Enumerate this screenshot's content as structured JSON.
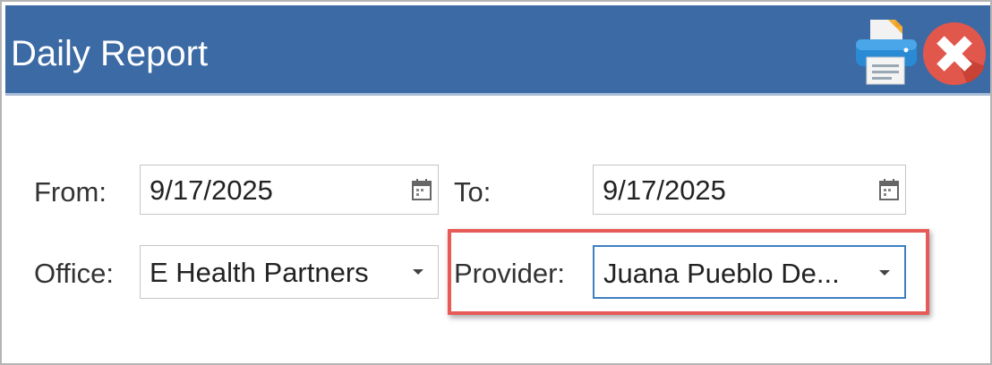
{
  "window": {
    "title": "Daily Report"
  },
  "toolbar": {
    "print_icon": "printer-icon",
    "close_icon": "close-icon"
  },
  "form": {
    "from_label": "From:",
    "from_value": "9/17/2025",
    "to_label": "To:",
    "to_value": "9/17/2025",
    "office_label": "Office:",
    "office_value": "E Health Partners",
    "provider_label": "Provider:",
    "provider_value": "Juana Pueblo De..."
  },
  "colors": {
    "titlebar": "#3c6aa4",
    "highlight": "#e65b57",
    "focus_border": "#3f7fc0"
  }
}
